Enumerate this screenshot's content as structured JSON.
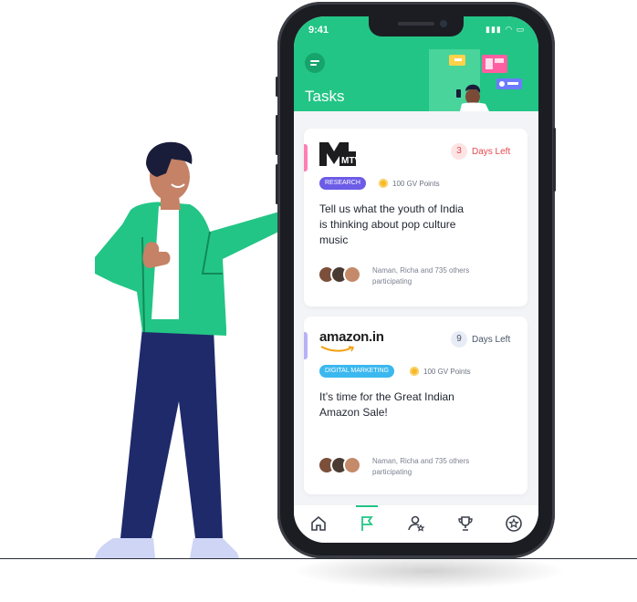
{
  "status_bar": {
    "time": "9:41",
    "icons": "▮▮▮ ◠ ▭"
  },
  "header": {
    "title": "Tasks"
  },
  "tasks": [
    {
      "brand": "MTV",
      "days_number": "3",
      "days_label": "Days Left",
      "tag": "Research",
      "points": "100 GV Points",
      "text": "Tell us what the youth of India is thinking about pop culture music",
      "participants": "Naman, Richa and 735 others participating"
    },
    {
      "brand": "amazon.in",
      "days_number": "9",
      "days_label": "Days Left",
      "tag": "Digital Marketing",
      "points": "100 GV Points",
      "text": "It’s time for the Great Indian Amazon Sale!",
      "participants": "Naman, Richa and 735 others participating"
    }
  ],
  "nav": {
    "items": [
      "home-icon",
      "flag-icon",
      "profile-icon",
      "trophy-icon",
      "star-icon"
    ],
    "active_index": 1
  },
  "colors": {
    "primary_green": "#22c585",
    "urgent_red": "#e5484d",
    "research_tag": "#6c5ce7",
    "marketing_tag": "#3bb8ef",
    "coin": "#f7b928"
  }
}
